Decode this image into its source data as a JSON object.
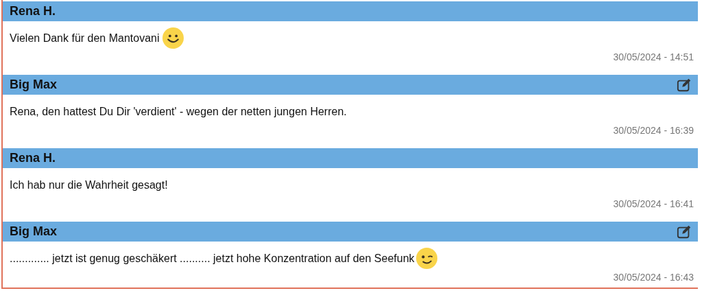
{
  "messages": [
    {
      "author": "Rena H.",
      "editable": false,
      "text": "Vielen Dank für den Mantovani",
      "kind": "smile",
      "time": "30/05/2024 - 14:51"
    },
    {
      "author": "Big Max",
      "editable": true,
      "text": "Rena, den hattest Du Dir 'verdient' - wegen der netten jungen Herren.",
      "kind": "plain",
      "time": "30/05/2024 - 16:39"
    },
    {
      "author": "Rena H.",
      "editable": false,
      "text": "Ich hab nur die Wahrheit gesagt!",
      "kind": "plain",
      "time": "30/05/2024 - 16:41"
    },
    {
      "author": "Big Max",
      "editable": true,
      "text": "............. jetzt ist genug geschäkert .......... jetzt hohe Konzentration auf den Seefunk",
      "kind": "wink",
      "time": "30/05/2024 - 16:43"
    }
  ]
}
